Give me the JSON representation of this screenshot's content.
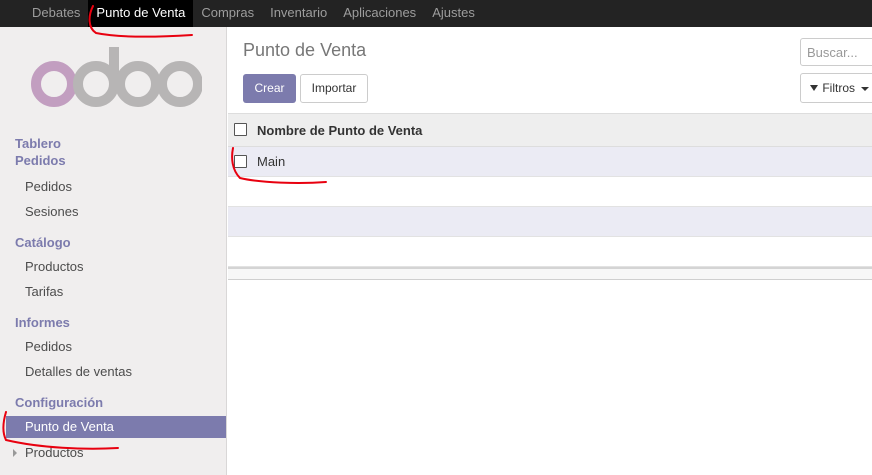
{
  "topnav": {
    "items": [
      {
        "label": "Debates",
        "active": false
      },
      {
        "label": "Punto de Venta",
        "active": true
      },
      {
        "label": "Compras",
        "active": false
      },
      {
        "label": "Inventario",
        "active": false
      },
      {
        "label": "Aplicaciones",
        "active": false
      },
      {
        "label": "Ajustes",
        "active": false
      }
    ]
  },
  "sidebar": {
    "logo": {
      "text": "odoo",
      "colors": {
        "o1": "#c29ec0",
        "rest": "#b7b5b5"
      }
    },
    "sections": {
      "tablero": "Tablero",
      "pedidos": "Pedidos",
      "catalogo": "Catálogo",
      "informes": "Informes",
      "configuracion": "Configuración"
    },
    "items": {
      "pedidos": "Pedidos",
      "sesiones": "Sesiones",
      "productos": "Productos",
      "tarifas": "Tarifas",
      "informes_pedidos": "Pedidos",
      "detalles_ventas": "Detalles de ventas",
      "punto_de_venta": "Punto de Venta",
      "config_productos": "Productos"
    }
  },
  "control_panel": {
    "title": "Punto de Venta",
    "create_label": "Crear",
    "import_label": "Importar",
    "search_placeholder": "Buscar...",
    "filters_label": "Filtros"
  },
  "list": {
    "column_header": "Nombre de Punto de Venta",
    "rows": [
      {
        "name": "Main"
      }
    ]
  },
  "colors": {
    "accent": "#7c7bad",
    "topbar": "#232323",
    "annotation": "#e8000f"
  }
}
